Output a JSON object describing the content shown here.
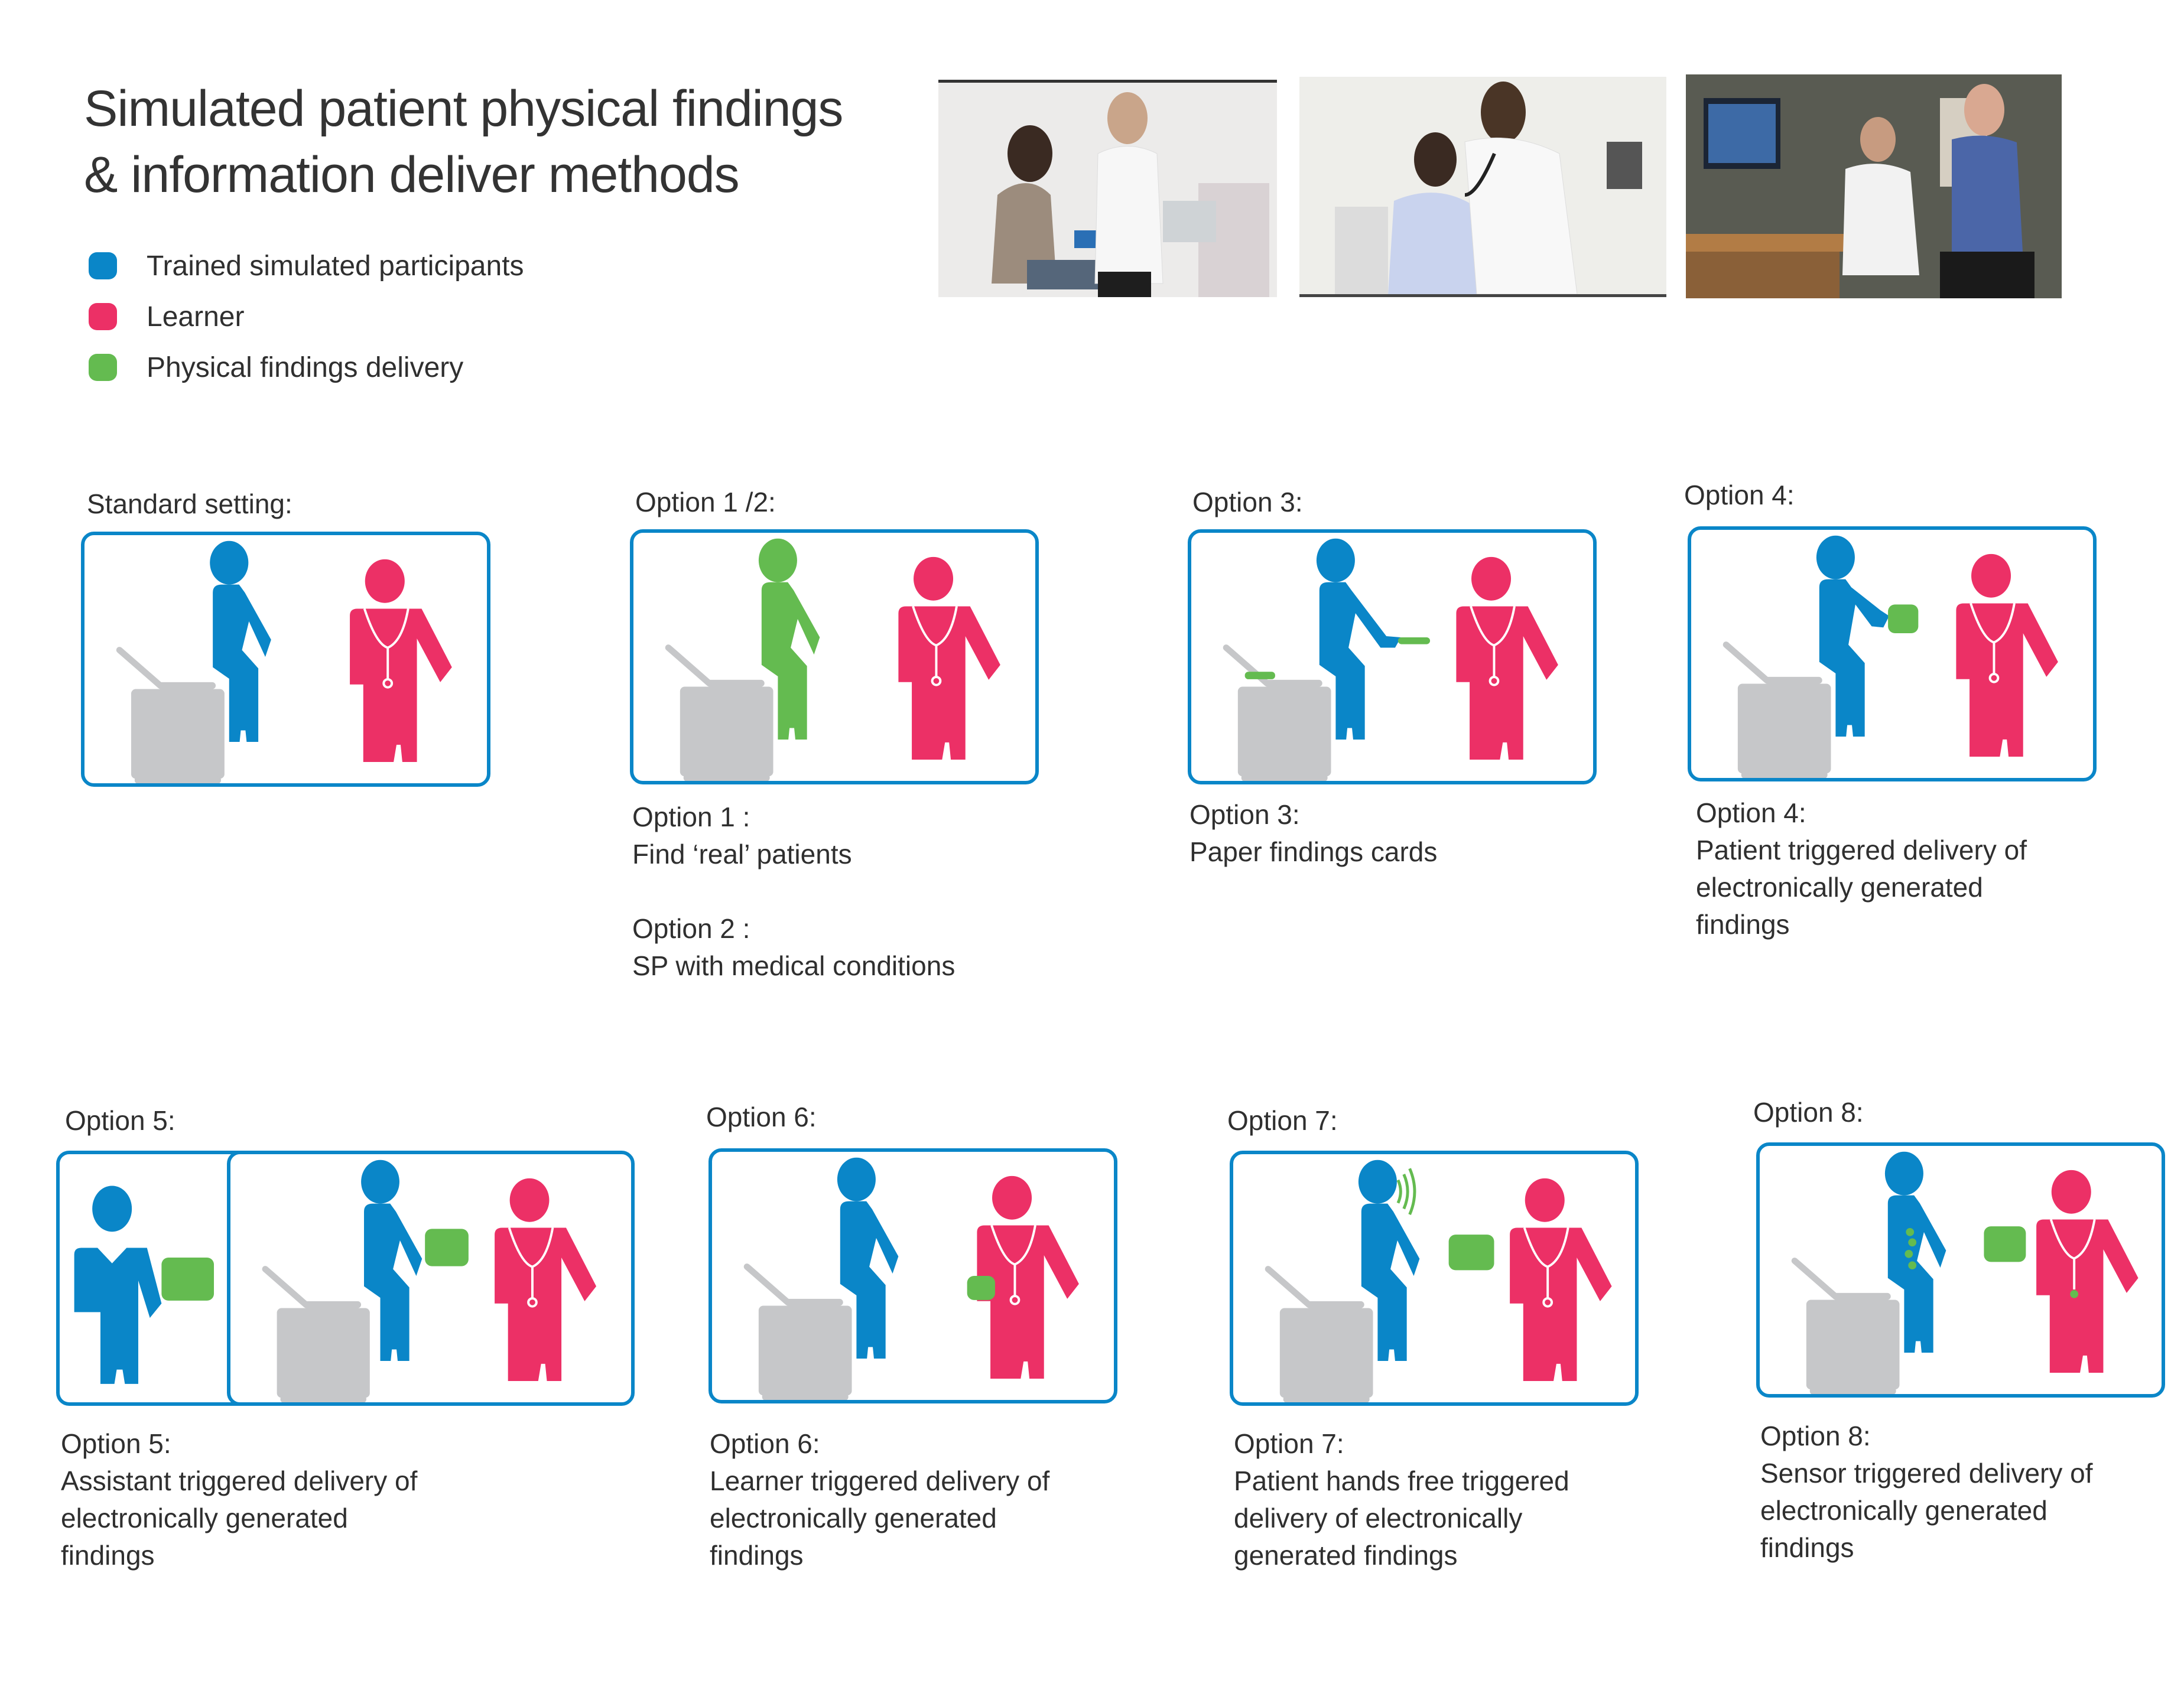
{
  "title": {
    "line1": "Simulated patient physical findings",
    "line2": "& information deliver methods"
  },
  "colors": {
    "sp_blue": "#0a86c8",
    "learner_pink": "#ec3066",
    "findings_green": "#64bb50",
    "bed_gray": "#c6c7c9",
    "frame_blue": "#0a86c8"
  },
  "legend": [
    {
      "label": "Trained simulated participants",
      "color": "#0a86c8"
    },
    {
      "label": "Learner",
      "color": "#ec3066"
    },
    {
      "label": "Physical findings delivery",
      "color": "#64bb50"
    }
  ],
  "photos": [
    {
      "name": "photo-doctor-with-seated-patient",
      "icon": "clinic-photo"
    },
    {
      "name": "photo-doctor-auscultating-patient",
      "icon": "clinic-photo"
    },
    {
      "name": "photo-doctor-pointing-at-screen",
      "icon": "clinic-photo"
    }
  ],
  "options": [
    {
      "id": "standard",
      "heading": "Standard setting:",
      "desc": []
    },
    {
      "id": "opt12",
      "heading": "Option 1 /2:",
      "desc": [
        "Option 1 :",
        "Find ‘real’ patients",
        "",
        "Option 2 :",
        "SP with medical conditions"
      ]
    },
    {
      "id": "opt3",
      "heading": "Option 3:",
      "desc": [
        "Option 3:",
        "Paper findings cards"
      ]
    },
    {
      "id": "opt4",
      "heading": "Option 4:",
      "desc": [
        "Option 4:",
        "Patient triggered delivery of",
        "electronically generated",
        "findings"
      ]
    },
    {
      "id": "opt5",
      "heading": "Option 5:",
      "desc": [
        "Option 5:",
        "Assistant triggered delivery of",
        "electronically generated",
        "findings"
      ]
    },
    {
      "id": "opt6",
      "heading": "Option 6:",
      "desc": [
        "Option 6:",
        "Learner triggered delivery of",
        "electronically generated",
        "findings"
      ]
    },
    {
      "id": "opt7",
      "heading": "Option 7:",
      "desc": [
        "Option 7:",
        "Patient hands free triggered",
        "delivery of electronically",
        "generated findings"
      ]
    },
    {
      "id": "opt8",
      "heading": "Option 8:",
      "desc": [
        "Option 8:",
        "Sensor triggered delivery of",
        "electronically generated",
        "findings"
      ]
    }
  ]
}
